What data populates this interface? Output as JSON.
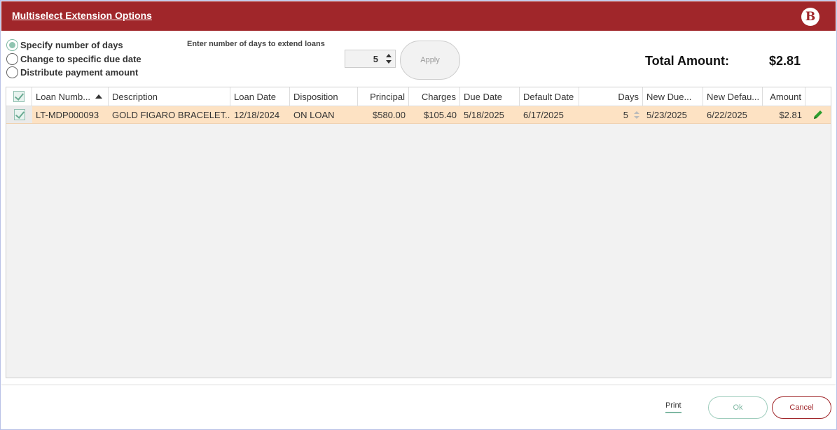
{
  "window": {
    "title": "Multiselect Extension Options",
    "logo_letter": "B"
  },
  "options": {
    "radios": [
      {
        "label": "Specify number of days",
        "checked": true
      },
      {
        "label": "Change to specific due date",
        "checked": false
      },
      {
        "label": "Distribute payment amount",
        "checked": false
      }
    ],
    "days_label": "Enter number of days to extend loans",
    "days_value": "5",
    "apply_label": "Apply"
  },
  "total": {
    "label": "Total Amount:",
    "value": "$2.81"
  },
  "grid": {
    "columns": [
      "Loan Numb...",
      "Description",
      "Loan Date",
      "Disposition",
      "Principal",
      "Charges",
      "Due Date",
      "Default Date",
      "Days",
      "New Due...",
      "New Defau...",
      "Amount"
    ],
    "rows": [
      {
        "loan_number": "LT-MDP000093",
        "description": "GOLD FIGARO BRACELET...",
        "loan_date": "12/18/2024",
        "disposition": "ON LOAN",
        "principal": "$580.00",
        "charges": "$105.40",
        "due_date": "5/18/2025",
        "default_date": "6/17/2025",
        "days": "5",
        "new_due": "5/23/2025",
        "new_default": "6/22/2025",
        "amount": "$2.81"
      }
    ]
  },
  "footer": {
    "print_label": "Print",
    "ok_label": "Ok",
    "cancel_label": "Cancel"
  },
  "colors": {
    "title_bar": "#a0262a",
    "row_highlight": "#fde2c3",
    "accent": "#7fb8a3",
    "edit_icon": "#2e9e2e"
  }
}
